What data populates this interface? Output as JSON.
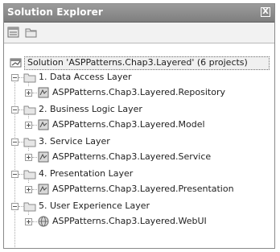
{
  "window": {
    "title": "Solution Explorer",
    "close_glyph": "X"
  },
  "toolbar": {
    "buttons": [
      {
        "icon": "properties-icon"
      },
      {
        "icon": "show-all-files-icon"
      }
    ]
  },
  "tree": {
    "solution": {
      "label": "Solution 'ASPPatterns.Chap3.Layered' (6 projects)",
      "icon": "solution-icon"
    },
    "folders": [
      {
        "label": "1. Data Access Layer",
        "icon": "folder-icon",
        "expanded": true,
        "project": {
          "label": "ASPPatterns.Chap3.Layered.Repository",
          "icon": "csharp-project-icon",
          "expanded": false
        }
      },
      {
        "label": "2. Business Logic Layer",
        "icon": "folder-icon",
        "expanded": true,
        "project": {
          "label": "ASPPatterns.Chap3.Layered.Model",
          "icon": "csharp-project-icon",
          "expanded": false
        }
      },
      {
        "label": "3. Service Layer",
        "icon": "folder-icon",
        "expanded": true,
        "project": {
          "label": "ASPPatterns.Chap3.Layered.Service",
          "icon": "csharp-project-icon",
          "expanded": false
        }
      },
      {
        "label": "4. Presentation Layer",
        "icon": "folder-icon",
        "expanded": true,
        "project": {
          "label": "ASPPatterns.Chap3.Layered.Presentation",
          "icon": "csharp-project-icon",
          "expanded": false
        }
      },
      {
        "label": "5. User Experience Layer",
        "icon": "folder-icon",
        "expanded": true,
        "project": {
          "label": "ASPPatterns.Chap3.Layered.WebUI",
          "icon": "web-project-icon",
          "expanded": false
        }
      }
    ]
  }
}
